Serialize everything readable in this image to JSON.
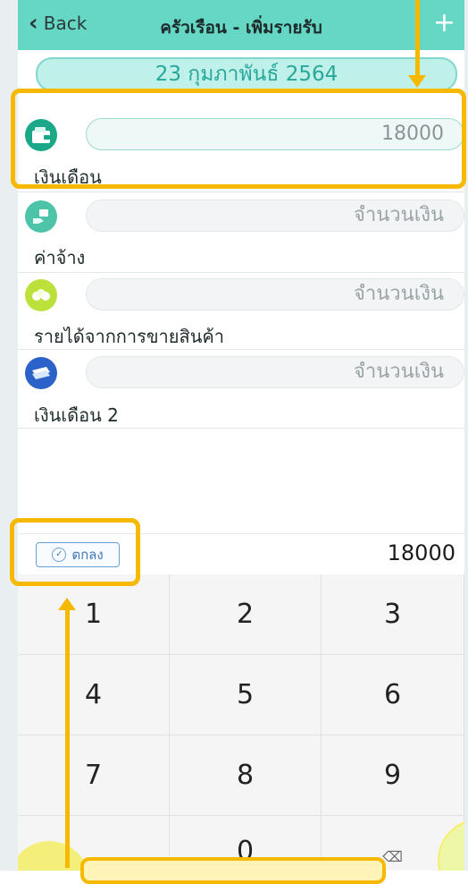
{
  "nav": {
    "back_label": "Back",
    "title": "ครัวเรือน - เพิ่มรายรับ",
    "add_icon": "plus-icon"
  },
  "date": "23 กุมภาพันธ์ 2564",
  "income_rows": [
    {
      "label": "เงินเดือน",
      "value": "18000",
      "icon": "wallet-icon",
      "icon_color": "#1aa889"
    },
    {
      "label": "ค่าจ้าง",
      "placeholder": "จำนวนเงิน",
      "icon": "hand-money-icon",
      "icon_color": "#4dc3a8"
    },
    {
      "label": "รายได้จากการขายสินค้า",
      "placeholder": "จำนวนเงิน",
      "icon": "coins-icon",
      "icon_color": "#bde13b"
    },
    {
      "label": "เงินเดือน 2",
      "placeholder": "จำนวนเงิน",
      "icon": "cash-stack-icon",
      "icon_color": "#2a62c9"
    }
  ],
  "keyboard": {
    "ok_label": "ตกลง",
    "display_value": "18000",
    "keys": [
      "1",
      "2",
      "3",
      "4",
      "5",
      "6",
      "7",
      "8",
      "9",
      "",
      "0",
      "⌫"
    ]
  },
  "colors": {
    "nav_bg": "#66d6c5",
    "accent_teal": "#27a89a",
    "highlight_yellow": "#f7b800"
  }
}
